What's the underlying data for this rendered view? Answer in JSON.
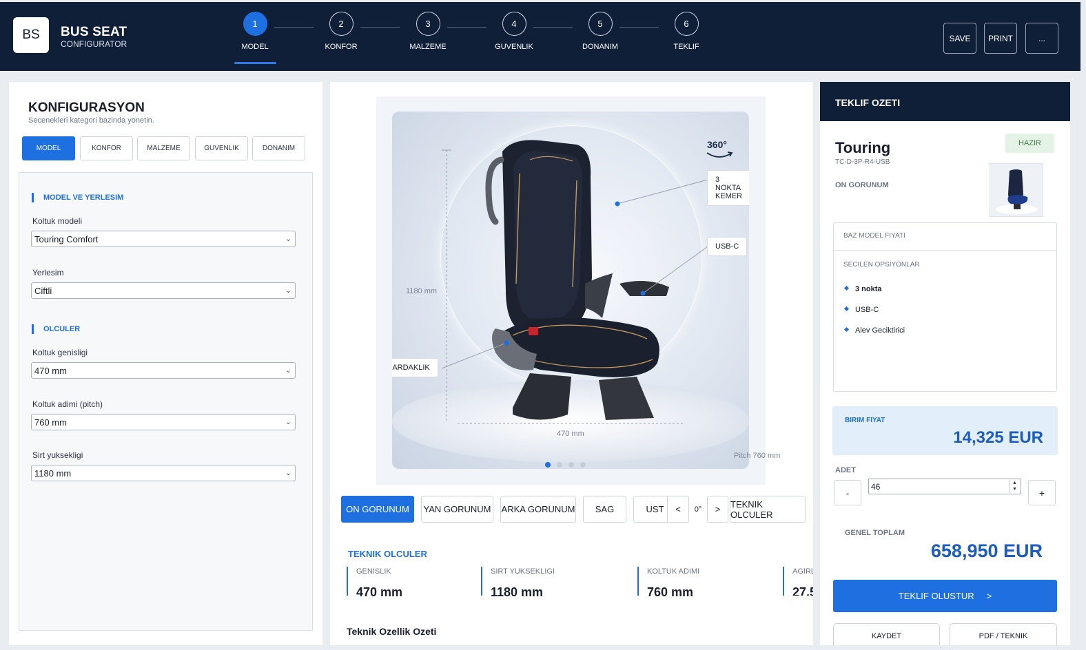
{
  "header": {
    "logo_text": "BS",
    "app_title": "BUS SEAT",
    "app_subtitle": "CONFIGURATOR",
    "steps": [
      {
        "num": "1",
        "label": "MODEL"
      },
      {
        "num": "2",
        "label": "KONFOR"
      },
      {
        "num": "3",
        "label": "MALZEME"
      },
      {
        "num": "4",
        "label": "GUVENLIK"
      },
      {
        "num": "5",
        "label": "DONANIM"
      },
      {
        "num": "6",
        "label": "TEKLIF"
      }
    ],
    "active_step": 1,
    "save_label": "SAVE",
    "print_label": "PRINT",
    "more_label": "..."
  },
  "config": {
    "title": "KONFIGURASYON",
    "subtitle": "Secenekleri kategori bazinda yonetin.",
    "categories": [
      "MODEL",
      "KONFOR",
      "MALZEME",
      "GUVENLIK",
      "DONANIM"
    ],
    "section_model": "MODEL VE YERLESIM",
    "seat_model_label": "Koltuk modeli",
    "seat_model_value": "Touring Comfort",
    "layout_label": "Yerlesim",
    "layout_value": "Ciftli",
    "section_dims": "OLCULER",
    "width_label": "Koltuk genisligi",
    "width_value": "470 mm",
    "pitch_label": "Koltuk adimi (pitch)",
    "pitch_value": "760 mm",
    "back_label": "Sirt yuksekligi",
    "back_value": "1180 mm"
  },
  "viewer": {
    "rotate_label": "360°",
    "tags": {
      "belt": "3 NOKTA KEMER",
      "usb": "USB-C",
      "cup": "BARDAKLIK"
    },
    "dim_height": "1180 mm",
    "dim_width": "470 mm",
    "dim_pitch": "Pitch 760 mm",
    "active_dot": 0,
    "views": [
      "ON GORUNUM",
      "YAN GORUNUM",
      "ARKA GORUNUM",
      "SAG",
      "UST"
    ],
    "rotate_prev": "<",
    "rotate_angle": "0°",
    "rotate_next": ">",
    "tech_button": "TEKNIK OLCULER"
  },
  "tech": {
    "title": "TEKNIK OLCULER",
    "metrics": [
      {
        "label": "GENISLIK",
        "value": "470 mm"
      },
      {
        "label": "SIRT YUKSEKLIGI",
        "value": "1180 mm"
      },
      {
        "label": "KOLTUK ADIMI",
        "value": "760 mm"
      },
      {
        "label": "AGIRL",
        "value": "27.5"
      }
    ],
    "spec_title": "Teknik Ozellik Ozeti"
  },
  "quote": {
    "title": "TEKLIF OZETI",
    "model_name": "Touring",
    "model_code": "TC-D-3P-R4-USB",
    "status": "HAZIR",
    "view_label": "ON GORUNUM",
    "base_price_label": "BAZ MODEL FIYATI",
    "selected_label": "SECILEN OPSIYONLAR",
    "options": [
      "3 nokta",
      "USB-C",
      "Alev Geciktirici"
    ],
    "unit_price_label": "BIRIM FIYAT",
    "unit_price": "14,325 EUR",
    "qty_label": "ADET",
    "qty_minus": "-",
    "qty_value": "46",
    "qty_plus": "+",
    "total_label": "GENEL TOPLAM",
    "total_value": "658,950 EUR",
    "cta_label": "TEKLIF OLUSTUR",
    "cta_arrow": ">",
    "save_label": "KAYDET",
    "pdf_label": "PDF / TEKNIK"
  },
  "colors": {
    "navy": "#0f1f38",
    "accent": "#1e6fe0",
    "status_green_bg": "#e4f3e6",
    "status_green_text": "#3d7a45"
  }
}
